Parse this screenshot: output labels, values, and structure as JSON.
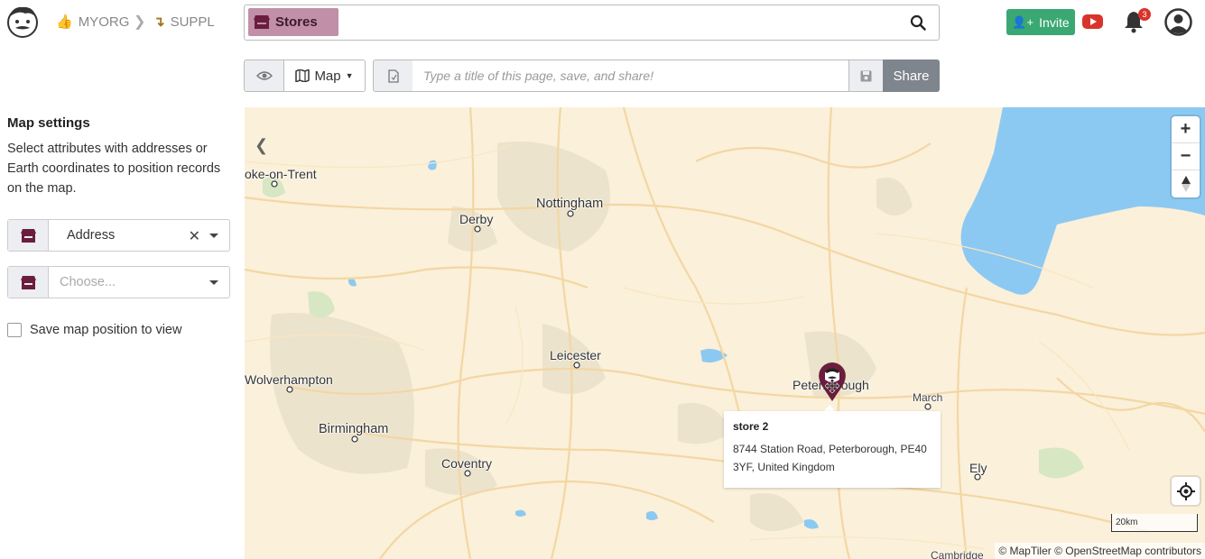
{
  "header": {
    "breadcrumb": {
      "org": "MYORG",
      "supplier": "SUPPL"
    },
    "search_chip": "Stores",
    "invite_label": "Invite",
    "notification_count": "3"
  },
  "toolbar": {
    "view_select": "Map",
    "title_placeholder": "Type a title of this page, save, and share!",
    "share_label": "Share"
  },
  "sidebar": {
    "title": "Map settings",
    "description": "Select attributes with addresses or Earth coordinates to position records on the map.",
    "attribute_1": "Address",
    "attribute_2_placeholder": "Choose...",
    "save_position_label": "Save map position to view"
  },
  "map": {
    "cities": [
      {
        "name": "oke-on-Trent"
      },
      {
        "name": "Nottingham"
      },
      {
        "name": "Derby"
      },
      {
        "name": "Leicester"
      },
      {
        "name": "Wolverhampton"
      },
      {
        "name": "Birmingham"
      },
      {
        "name": "Coventry"
      },
      {
        "name": "Peterborough"
      },
      {
        "name": "March"
      },
      {
        "name": "Ely"
      },
      {
        "name": "Cambridge"
      }
    ],
    "popup": {
      "name": "store 2",
      "address": "8744 Station Road, Peterborough, PE40 3YF, United Kingdom"
    },
    "scale_label": "20km",
    "attribution": "© MapTiler © OpenStreetMap contributors"
  },
  "colors": {
    "accent_chip": "#c28fa8",
    "invite_green": "#3aa872",
    "share_gray": "#7e858c",
    "marker": "#6b1d3d",
    "water": "#8cc9f2"
  }
}
